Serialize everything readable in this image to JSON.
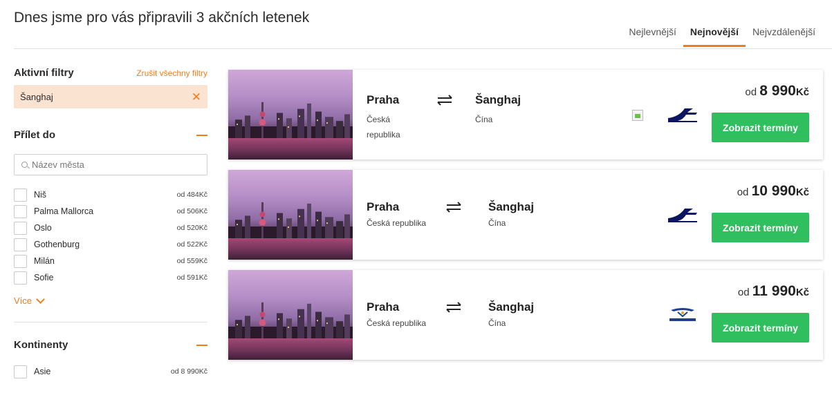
{
  "header": {
    "title": "Dnes jsme pro vás připravili 3 akčních letenek",
    "sort_tabs": [
      {
        "label": "Nejlevnější",
        "active": false
      },
      {
        "label": "Nejnovější",
        "active": true
      },
      {
        "label": "Nejvzdálenější",
        "active": false
      }
    ]
  },
  "sidebar": {
    "active_filters": {
      "title": "Aktivní filtry",
      "clear_label": "Zrušit všechny filtry",
      "chips": [
        {
          "label": "Šanghaj",
          "icon": "close-icon"
        }
      ]
    },
    "arrivals": {
      "title": "Přílet do",
      "search_placeholder": "Název města",
      "cities": [
        {
          "name": "Niš",
          "price": "od 484Kč"
        },
        {
          "name": "Palma Mallorca",
          "price": "od 506Kč"
        },
        {
          "name": "Oslo",
          "price": "od 520Kč"
        },
        {
          "name": "Gothenburg",
          "price": "od 522Kč"
        },
        {
          "name": "Milán",
          "price": "od 559Kč"
        },
        {
          "name": "Sofie",
          "price": "od 591Kč"
        }
      ],
      "more_label": "Více"
    },
    "continents": {
      "title": "Kontinenty",
      "items": [
        {
          "name": "Asie",
          "price": "od 8 990Kč"
        }
      ]
    }
  },
  "offers": [
    {
      "from": "Praha",
      "from_country": "Česká republika",
      "to": "Šanghaj",
      "to_country": "Čína",
      "airline": "finnair-logo",
      "broken_image": true,
      "price_prefix": "od",
      "price": "8 990",
      "currency": "Kč",
      "button": "Zobrazit termíny"
    },
    {
      "from": "Praha",
      "from_country": "Česká republika",
      "to": "Šanghaj",
      "to_country": "Čína",
      "airline": "finnair-logo",
      "broken_image": false,
      "price_prefix": "od",
      "price": "10 990",
      "currency": "Kč",
      "button": "Zobrazit termíny"
    },
    {
      "from": "Praha",
      "from_country": "Česká republika",
      "to": "Šanghaj",
      "to_country": "Čína",
      "airline": "aeroflot-logo",
      "broken_image": false,
      "price_prefix": "od",
      "price": "11 990",
      "currency": "Kč",
      "button": "Zobrazit termíny"
    }
  ],
  "colors": {
    "accent": "#f07c1d",
    "button": "#2fbf5f",
    "chip_bg": "#fbe3d1",
    "finnair_blue": "#0b1560",
    "aeroflot_blue": "#1d3f8e"
  }
}
